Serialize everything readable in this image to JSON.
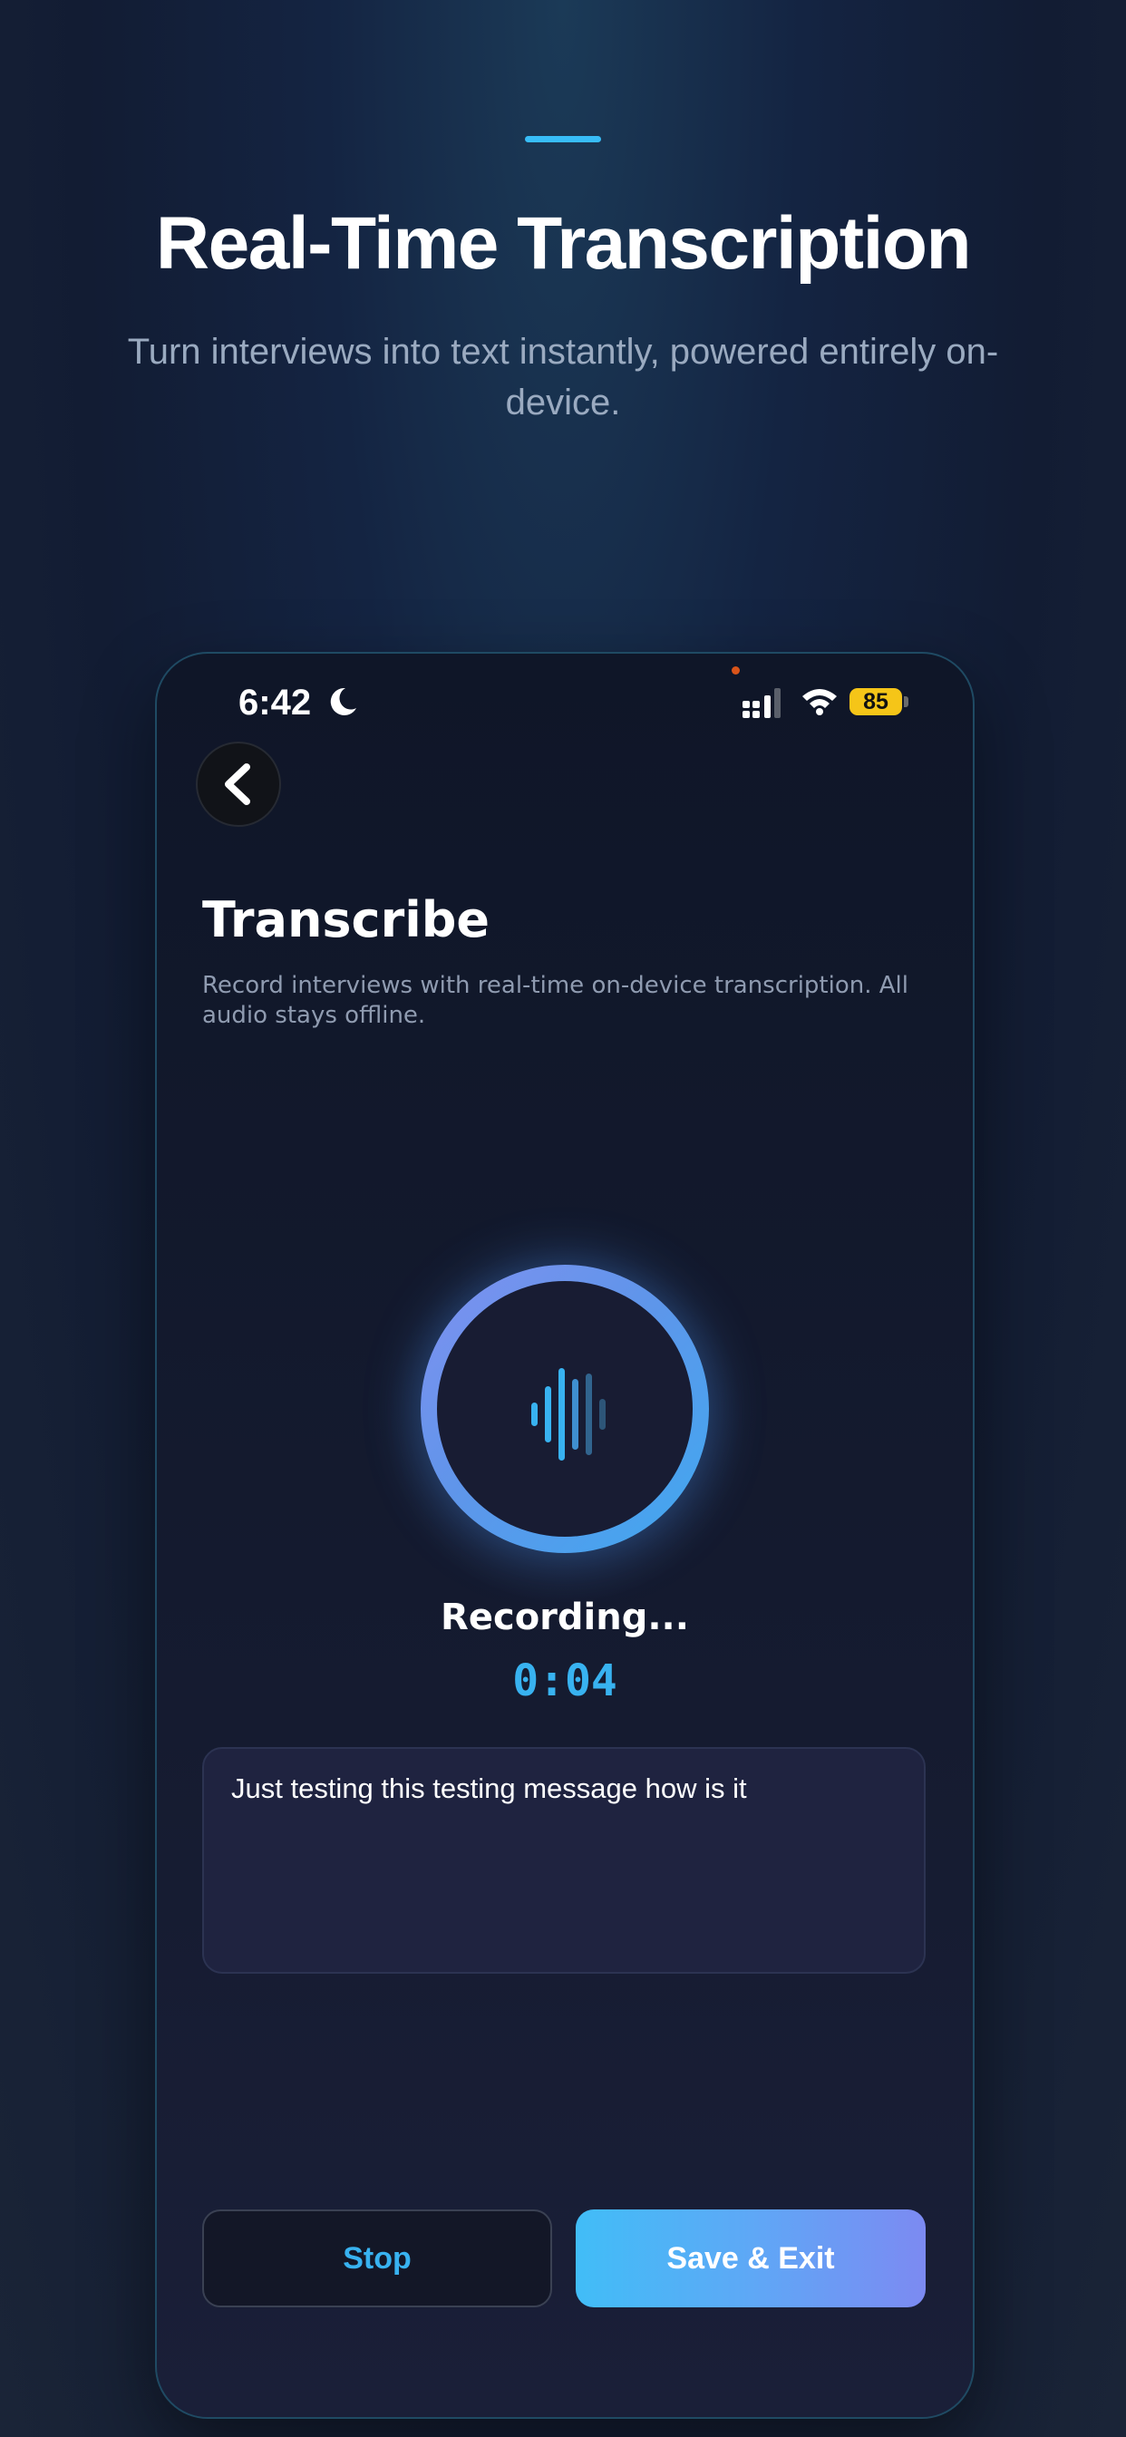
{
  "hero": {
    "title": "Real-Time Transcription",
    "subtitle": "Turn interviews into text instantly, powered entirely on-device."
  },
  "status_bar": {
    "time": "6:42",
    "battery": "85",
    "icons": [
      "moon-icon",
      "signal-icon",
      "wifi-icon",
      "battery-icon"
    ]
  },
  "screen": {
    "title": "Transcribe",
    "description": "Record interviews with real-time on-device transcription. All audio stays offline.",
    "recording_label": "Recording...",
    "timer": "0:04",
    "transcript": "Just testing this testing message how is it"
  },
  "buttons": {
    "stop": "Stop",
    "save_exit": "Save & Exit"
  },
  "colors": {
    "accent": "#38b2f0",
    "battery": "#f5c518",
    "gradient_start": "#41bdf7",
    "gradient_end": "#7c8af2"
  }
}
